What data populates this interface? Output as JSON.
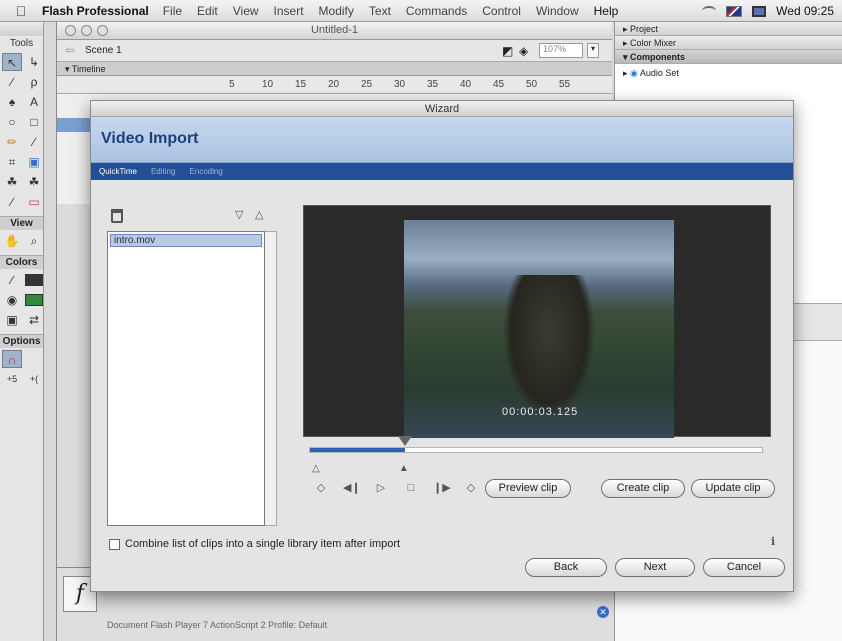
{
  "menubar": {
    "app": "Flash Professional",
    "items": [
      "File",
      "Edit",
      "View",
      "Insert",
      "Modify",
      "Text",
      "Commands",
      "Control",
      "Window",
      "Help"
    ],
    "clock": "Wed 09:25"
  },
  "tools": {
    "title": "Tools",
    "view_label": "View",
    "colors_label": "Colors",
    "options_label": "Options"
  },
  "document": {
    "title": "Untitled-1",
    "scene": "Scene 1",
    "zoom": "107%",
    "timeline_label": "Timeline",
    "frame_numbers": [
      "5",
      "10",
      "15",
      "20",
      "25",
      "30",
      "35",
      "40",
      "45",
      "50",
      "55"
    ],
    "props_line": "Document        Flash Player 7    ActionScript 2    Profile: Default"
  },
  "panels": {
    "project": "Project",
    "color_mixer": "Color Mixer",
    "components": "Components",
    "audio_set": "Audio Set"
  },
  "wizard": {
    "title": "Wizard",
    "heading": "Video Import",
    "steps": [
      "QuickTime",
      "Editing",
      "Encoding"
    ],
    "active_step": "QuickTime",
    "clip": "intro.mov",
    "timecode": "00:00:03.125",
    "progress": 0.21,
    "preview_label": "Preview clip",
    "create_label": "Create clip",
    "update_label": "Update clip",
    "combine_label": "Combine list of clips into a single library item after import",
    "back_label": "Back",
    "next_label": "Next",
    "cancel_label": "Cancel"
  },
  "colors": {
    "accent": "#244f96",
    "header_bg": "#a9c2e2",
    "scrub_fill": "#2f5fb8"
  }
}
